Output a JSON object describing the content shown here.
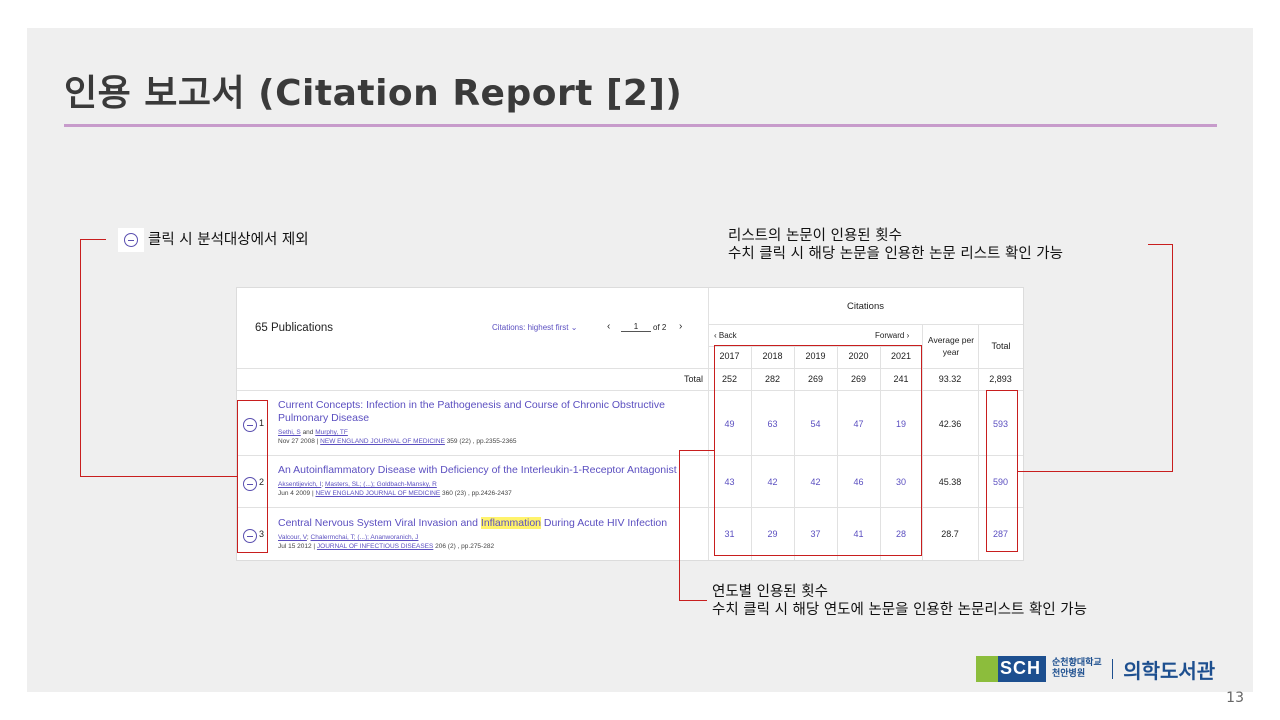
{
  "slide": {
    "title": "인용 보고서 (Citation Report [2])",
    "page_number": "13"
  },
  "annotations": {
    "exclude_note": "클릭 시 분석대상에서 제외",
    "right_note_line1": "리스트의 논문이 인용된 횟수",
    "right_note_line2": "수치 클릭 시 해당 논문을 인용한 논문 리스트 확인 가능",
    "bottom_note_line1": "연도별 인용된 횟수",
    "bottom_note_line2": "수치 클릭 시 해당 연도에 논문을 인용한 논문리스트 확인 가능"
  },
  "report": {
    "publications_label": "65 Publications",
    "sort_label": "Citations: highest first ⌄",
    "page_prev": "‹",
    "page_input": "1",
    "page_of": "of 2",
    "page_next": "›",
    "citations_header": "Citations",
    "back_label": "‹ Back",
    "forward_label": "Forward ›",
    "average_header": "Average per year",
    "total_header": "Total",
    "total_row_label": "Total",
    "years": [
      "2017",
      "2018",
      "2019",
      "2020",
      "2021"
    ],
    "year_totals": [
      "252",
      "282",
      "269",
      "269",
      "241"
    ],
    "average_total": "93.32",
    "grand_total": "2,893",
    "papers": [
      {
        "index": "1",
        "title": "Current Concepts: Infection in the Pathogenesis and Course of Chronic Obstructive Pulmonary Disease",
        "authors_a": "Sethi, S",
        "authors_sep": " and ",
        "authors_b": "Murphy, TF",
        "date": "Nov 27 2008 | ",
        "journal": "NEW ENGLAND JOURNAL OF MEDICINE",
        "citation": " 359 (22) , pp.2355-2365",
        "counts": [
          "49",
          "63",
          "54",
          "47",
          "19"
        ],
        "average": "42.36",
        "total": "593"
      },
      {
        "index": "2",
        "title": "An Autoinflammatory Disease with Deficiency of the Interleukin-1-Receptor Antagonist",
        "authors_a": "Aksentijevich, I",
        "authors_sep": "; ",
        "authors_b": "Masters, SL; (...); Goldbach-Mansky, R",
        "date": "Jun 4 2009 | ",
        "journal": "NEW ENGLAND JOURNAL OF MEDICINE",
        "citation": " 360 (23) , pp.2426-2437",
        "counts": [
          "43",
          "42",
          "42",
          "46",
          "30"
        ],
        "average": "45.38",
        "total": "590"
      },
      {
        "index": "3",
        "title_pre": "Central Nervous System Viral Invasion and ",
        "title_hl": "Inflammation",
        "title_post": " During Acute HIV Infection",
        "authors_a": "Valcour, V",
        "authors_sep": "; ",
        "authors_b": "Chalermchai, T; (...); Ananworanich, J",
        "date": "Jul 15 2012 | ",
        "journal": "JOURNAL OF INFECTIOUS DISEASES",
        "citation": " 206 (2) , pp.275-282",
        "counts": [
          "31",
          "29",
          "37",
          "41",
          "28"
        ],
        "average": "28.7",
        "total": "287"
      }
    ]
  },
  "footer": {
    "logo_text": "SCH",
    "univ_line1": "순천향대학교",
    "univ_line2": "천안병원",
    "library_name": "의학도서관"
  },
  "colors": {
    "accent_rule": "#c79bcb",
    "annotation_red": "#c81e1e",
    "link_purple": "#5b4fc0",
    "highlight": "#fff36b"
  }
}
